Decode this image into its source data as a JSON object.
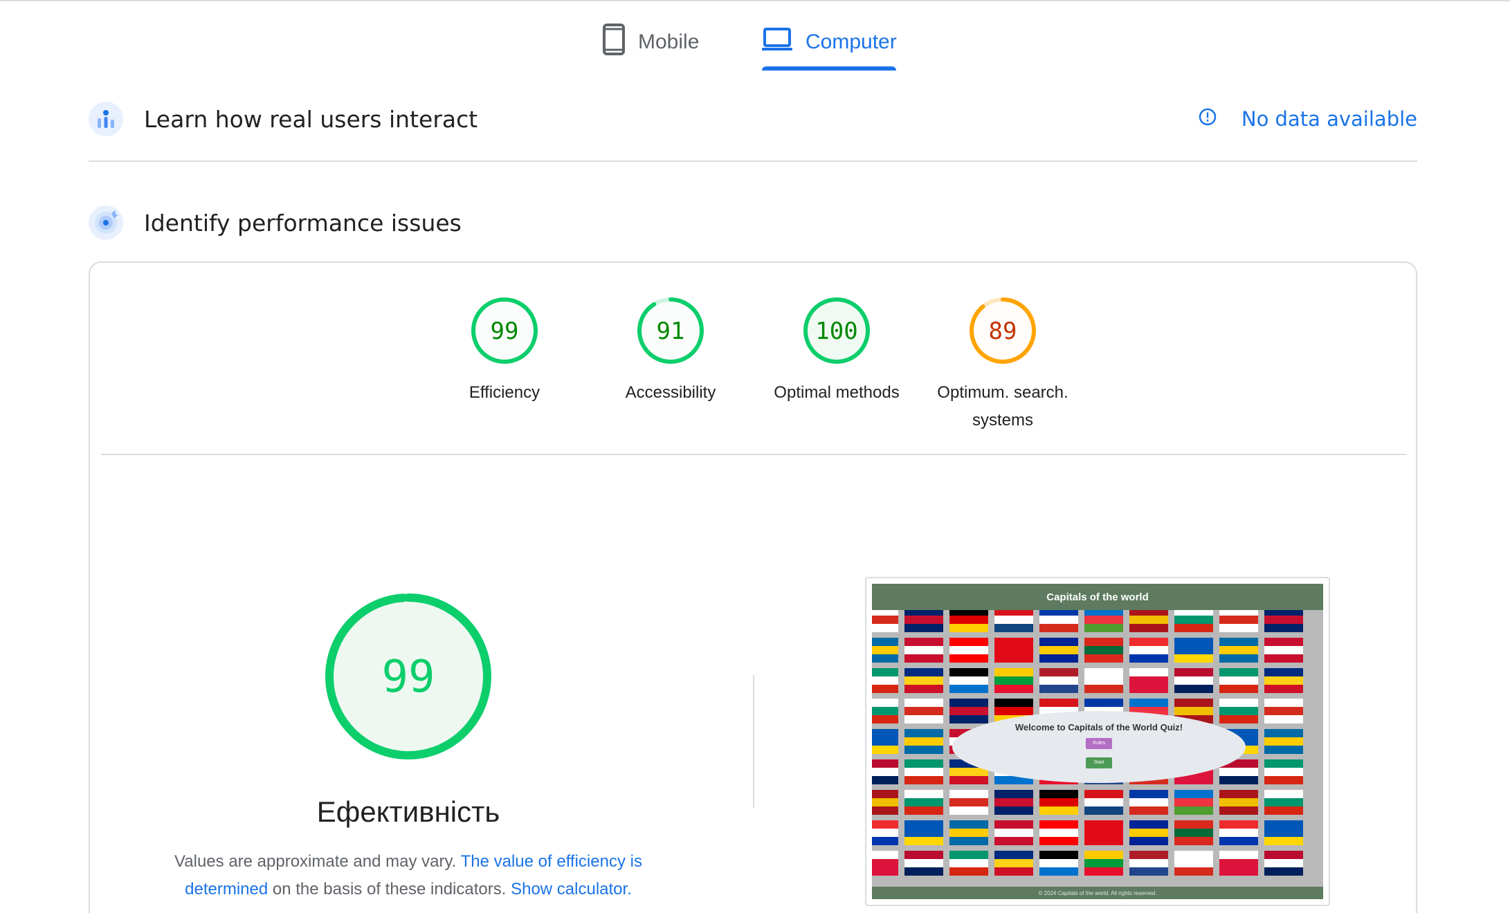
{
  "tabs": {
    "mobile_label": "Mobile",
    "computer_label": "Computer",
    "active": "Computer"
  },
  "sections": {
    "real_users_title": "Learn how real users interact",
    "no_data_label": "No data available",
    "performance_title": "Identify performance issues"
  },
  "scores": [
    {
      "label": "Efficiency",
      "value": "99",
      "status": "pass"
    },
    {
      "label": "Accessibility",
      "value": "91",
      "status": "pass"
    },
    {
      "label": "Optimal methods",
      "value": "100",
      "status": "pass"
    },
    {
      "label_line1": "Optimum. search.",
      "label_line2": "systems",
      "value": "89",
      "status": "average"
    }
  ],
  "main_score": {
    "value": "99",
    "title": "Ефективність",
    "note_prefix": "Values are approximate and may vary.",
    "note_link1": "The value of efficiency is determined",
    "note_middle": "on the basis of these indicators.",
    "note_link2": "Show calculator."
  },
  "preview": {
    "header": "Capitals of the world",
    "welcome": "Welcome to Capitals of the World Quiz!",
    "rules_label": "Rules",
    "start_label": "Start",
    "footer": "© 2024 Capitals of the world. All rights reserved."
  },
  "colors": {
    "accent": "#1a73e8",
    "pass": "#0cce6b",
    "pass_text": "#008800",
    "average": "#ffa400",
    "average_text": "#c33300"
  }
}
